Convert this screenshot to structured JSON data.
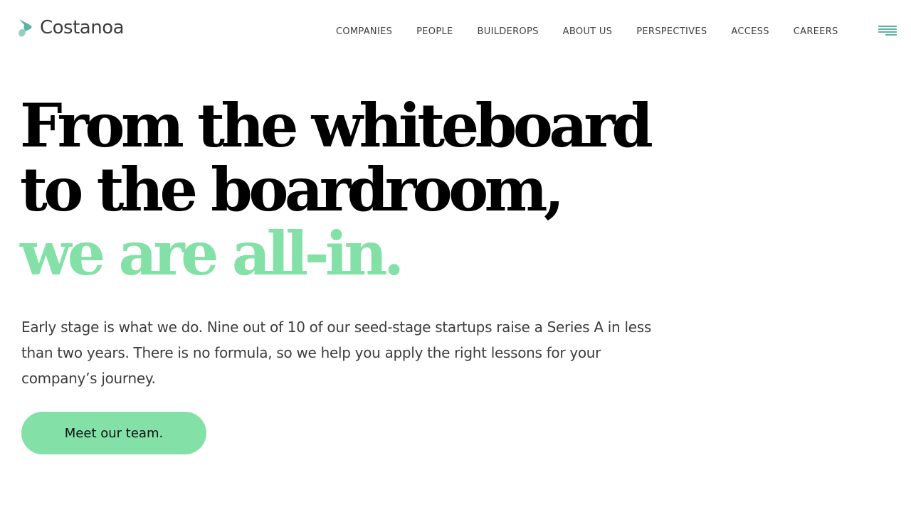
{
  "brand": {
    "name": "Costanoa",
    "logo_icon": "costanoa-chevron-icon",
    "accent_color": "#83e0a6",
    "logo_color": "#5fb3a4"
  },
  "nav": {
    "items": [
      {
        "label": "COMPANIES"
      },
      {
        "label": "PEOPLE"
      },
      {
        "label": "BUILDEROPS"
      },
      {
        "label": "ABOUT US"
      },
      {
        "label": "PERSPECTIVES"
      },
      {
        "label": "ACCESS"
      },
      {
        "label": "CAREERS"
      }
    ],
    "menu_icon": "hamburger-menu-icon"
  },
  "hero": {
    "headline_line1": "From the whiteboard",
    "headline_line2": "to the boardroom,",
    "headline_accent": "we are all-in.",
    "lead": "Early stage is what we do. Nine out of 10 of our seed-stage startups raise a Series A in less than two years. There is no formula, so we help you apply the right lessons for your company’s journey.",
    "cta_label": "Meet our team."
  }
}
